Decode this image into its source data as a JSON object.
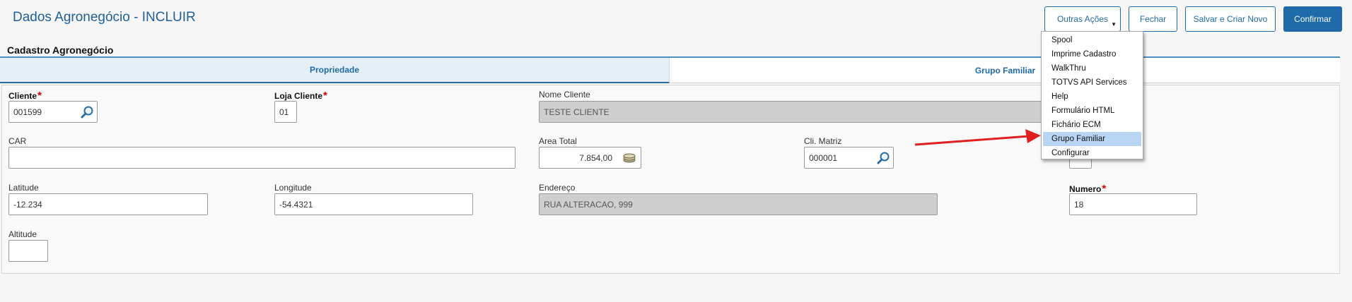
{
  "header": {
    "title": "Dados Agronegócio - INCLUIR",
    "buttons": {
      "outras_acoes": "Outras Ações",
      "fechar": "Fechar",
      "salvar_criar": "Salvar e Criar Novo",
      "confirmar": "Confirmar"
    }
  },
  "section": {
    "title": "Cadastro Agronegócio"
  },
  "tabs": [
    {
      "label": "Propriedade",
      "active": true
    },
    {
      "label": "Grupo Familiar",
      "active": false
    }
  ],
  "form": {
    "cliente": {
      "label": "Cliente",
      "value": "001599",
      "required": true
    },
    "loja_cliente": {
      "label": "Loja Cliente",
      "value": "01",
      "required": true
    },
    "nome_cliente": {
      "label": "Nome Cliente",
      "value": "TESTE CLIENTE"
    },
    "car": {
      "label": "CAR",
      "value": ""
    },
    "area_total": {
      "label": "Area Total",
      "value": "7.854,00"
    },
    "cli_matriz": {
      "label": "Cli. Matriz",
      "value": "000001"
    },
    "latitude": {
      "label": "Latitude",
      "value": "-12.234"
    },
    "longitude": {
      "label": "Longitude",
      "value": "-54.4321"
    },
    "endereco": {
      "label": "Endereço",
      "value": "RUA ALTERACAO, 999"
    },
    "numero": {
      "label": "Numero",
      "value": "18",
      "required": true
    },
    "altitude": {
      "label": "Altitude",
      "value": ""
    },
    "required_mark": "*"
  },
  "menu": {
    "items": [
      "Spool",
      "Imprime Cadastro",
      "WalkThru",
      "TOTVS API Services",
      "Help",
      "Formulário HTML",
      "Fichário ECM",
      "Grupo Familiar",
      "Configurar"
    ],
    "highlighted": "Grupo Familiar"
  },
  "colors": {
    "brand": "#1f6aa8",
    "required": "#d40000",
    "highlight": "#b9d5f4",
    "arrow": "#e02020"
  }
}
